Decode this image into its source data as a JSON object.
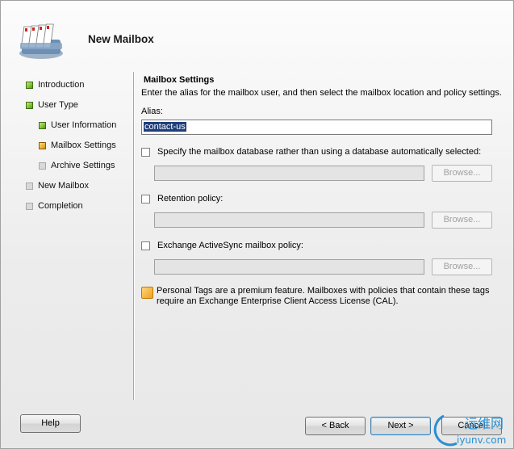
{
  "window": {
    "title": "New Mailbox"
  },
  "nav": {
    "items": [
      {
        "label": "Introduction",
        "status": "complete",
        "indent": 0
      },
      {
        "label": "User Type",
        "status": "complete",
        "indent": 0
      },
      {
        "label": "User Information",
        "status": "complete",
        "indent": 1
      },
      {
        "label": "Mailbox Settings",
        "status": "current",
        "indent": 1
      },
      {
        "label": "Archive Settings",
        "status": "pending",
        "indent": 1
      },
      {
        "label": "New Mailbox",
        "status": "pending",
        "indent": 0
      },
      {
        "label": "Completion",
        "status": "pending",
        "indent": 0
      }
    ]
  },
  "content": {
    "title": "Mailbox Settings",
    "description": "Enter the alias for the mailbox user, and then select the mailbox location and policy settings.",
    "alias_label": "Alias:",
    "alias_value": "contact-us",
    "options": [
      {
        "label": "Specify the mailbox database rather than using a database automatically selected:",
        "checked": false,
        "field_value": "",
        "browse_label": "Browse...",
        "browse_enabled": false
      },
      {
        "label": "Retention policy:",
        "checked": false,
        "field_value": "",
        "browse_label": "Browse...",
        "browse_enabled": false
      },
      {
        "label": "Exchange ActiveSync mailbox policy:",
        "checked": false,
        "field_value": "",
        "browse_label": "Browse...",
        "browse_enabled": false
      }
    ],
    "info_text": "Personal Tags are a premium feature. Mailboxes with policies that contain these tags require an Exchange Enterprise Client Access License (CAL)."
  },
  "buttons": {
    "help": "Help",
    "back": "< Back",
    "next": "Next >",
    "cancel": "Cancel"
  },
  "watermark": {
    "line1": "运维网",
    "line2": "iyunv.com"
  },
  "colors": {
    "complete": "#5aa61f",
    "current": "#e0a020",
    "pending": "#d9d9d9",
    "selection": "#1f3d7a",
    "watermark": "#2a8fd0"
  }
}
